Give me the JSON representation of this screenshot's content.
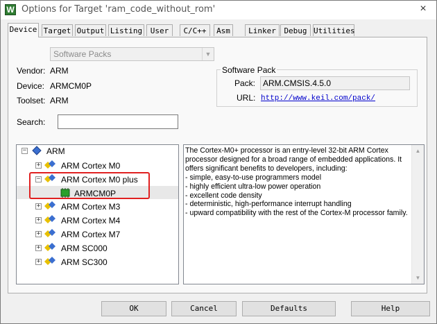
{
  "window": {
    "title": "Options for Target 'ram_code_without_rom'",
    "close_glyph": "×",
    "icon_glyph": "W"
  },
  "tabs": [
    {
      "label": "Device",
      "active": true
    },
    {
      "label": "Target"
    },
    {
      "label": "Output"
    },
    {
      "label": "Listing"
    },
    {
      "label": "User"
    },
    {
      "label": "C/C++"
    },
    {
      "label": "Asm"
    },
    {
      "label": "Linker"
    },
    {
      "label": "Debug"
    },
    {
      "label": "Utilities"
    }
  ],
  "device": {
    "pack_selector": "Software Packs",
    "vendor_label": "Vendor:",
    "vendor": "ARM",
    "device_label": "Device:",
    "device": "ARMCM0P",
    "toolset_label": "Toolset:",
    "toolset": "ARM",
    "search_label": "Search:",
    "search_value": ""
  },
  "software_pack": {
    "title": "Software Pack",
    "pack_label": "Pack:",
    "pack": "ARM.CMSIS.4.5.0",
    "url_label": "URL:",
    "url": "http://www.keil.com/pack/"
  },
  "tree": {
    "root": "ARM",
    "items": [
      "ARM Cortex M0",
      "ARM Cortex M0 plus",
      "ARMCM0P",
      "ARM Cortex M3",
      "ARM Cortex M4",
      "ARM Cortex M7",
      "ARM SC000",
      "ARM SC300"
    ],
    "expander_plus": "+",
    "expander_minus": "−"
  },
  "description": [
    "The Cortex-M0+ processor is an entry-level 32-bit ARM Cortex",
    "processor designed for a broad range of embedded applications. It",
    "offers significant benefits to developers, including:",
    "- simple, easy-to-use programmers model",
    "- highly efficient ultra-low power operation",
    "- excellent code density",
    "- deterministic, high-performance interrupt handling",
    "- upward compatibility with the rest of the Cortex-M processor family."
  ],
  "buttons": {
    "ok": "OK",
    "cancel": "Cancel",
    "defaults": "Defaults",
    "help": "Help"
  },
  "colors": {
    "highlight": "#e02020",
    "link": "#0000cc",
    "chip": "#2aa02a"
  }
}
